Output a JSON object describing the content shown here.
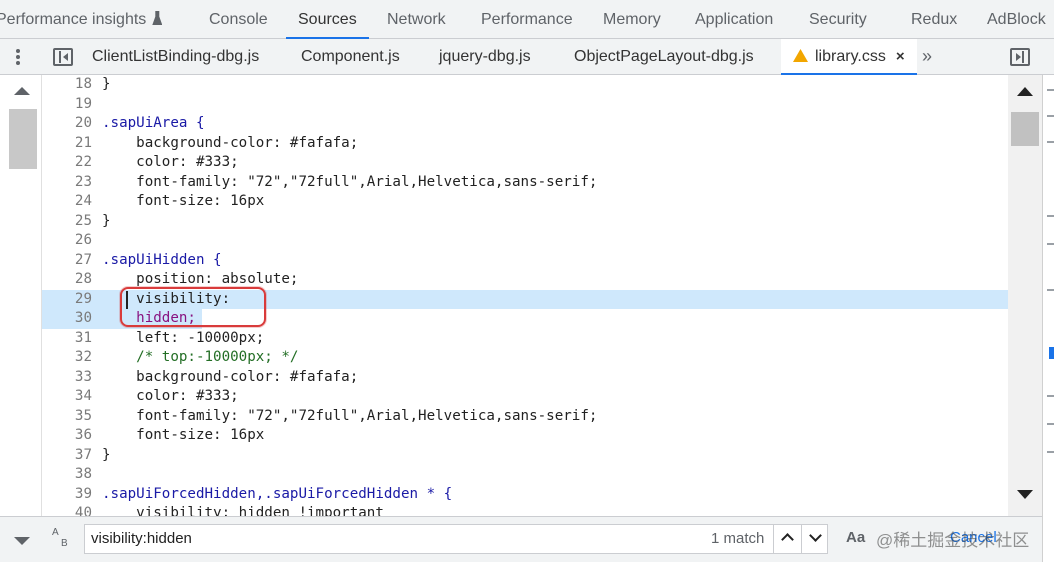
{
  "panel_tabs": [
    {
      "label": "Performance insights",
      "active": false
    },
    {
      "label": "Console",
      "active": false
    },
    {
      "label": "Sources",
      "active": true
    },
    {
      "label": "Network",
      "active": false
    },
    {
      "label": "Performance",
      "active": false
    },
    {
      "label": "Memory",
      "active": false
    },
    {
      "label": "Application",
      "active": false
    },
    {
      "label": "Security",
      "active": false
    },
    {
      "label": "Redux",
      "active": false
    },
    {
      "label": "AdBlock",
      "active": false
    }
  ],
  "file_tabs": [
    {
      "label": "ClientListBinding-dbg.js",
      "active": false
    },
    {
      "label": "Component.js",
      "active": false
    },
    {
      "label": "jquery-dbg.js",
      "active": false
    },
    {
      "label": "ObjectPageLayout-dbg.js",
      "active": false
    },
    {
      "label": "library.css",
      "active": true,
      "warning": true,
      "close": "×"
    }
  ],
  "more_tabs": "»",
  "code_lines": [
    {
      "n": "18",
      "text": "}"
    },
    {
      "n": "19",
      "text": ""
    },
    {
      "n": "20",
      "text": ".sapUiArea {"
    },
    {
      "n": "21",
      "text": "    background-color: #fafafa;"
    },
    {
      "n": "22",
      "text": "    color: #333;"
    },
    {
      "n": "23",
      "text": "    font-family: \"72\",\"72full\",Arial,Helvetica,sans-serif;"
    },
    {
      "n": "24",
      "text": "    font-size: 16px"
    },
    {
      "n": "25",
      "text": "}"
    },
    {
      "n": "26",
      "text": ""
    },
    {
      "n": "27",
      "text": ".sapUiHidden {"
    },
    {
      "n": "28",
      "text": "    position: absolute;"
    },
    {
      "n": "29",
      "text": "    visibility:"
    },
    {
      "n": "30",
      "text": "    hidden;"
    },
    {
      "n": "31",
      "text": "    left: -10000px;"
    },
    {
      "n": "32",
      "text": "    /* top:-10000px; */"
    },
    {
      "n": "33",
      "text": "    background-color: #fafafa;"
    },
    {
      "n": "34",
      "text": "    color: #333;"
    },
    {
      "n": "35",
      "text": "    font-family: \"72\",\"72full\",Arial,Helvetica,sans-serif;"
    },
    {
      "n": "36",
      "text": "    font-size: 16px"
    },
    {
      "n": "37",
      "text": "}"
    },
    {
      "n": "38",
      "text": ""
    },
    {
      "n": "39",
      "text": ".sapUiForcedHidden,.sapUiForcedHidden * {"
    },
    {
      "n": "40",
      "text": "    visibility: hidden !important"
    }
  ],
  "search": {
    "value": "visibility:hidden",
    "match_count": "1 match",
    "regex_label_top": "A",
    "regex_label_bottom": "B",
    "case_label": "Aa",
    "cancel_label": "Cancel"
  },
  "watermark": "@稀土掘金技术社区",
  "colors": {
    "accent": "#1a73e8",
    "highlight": "#cfe8fc",
    "annotation": "#d93b3b",
    "warning": "#f2a600"
  }
}
